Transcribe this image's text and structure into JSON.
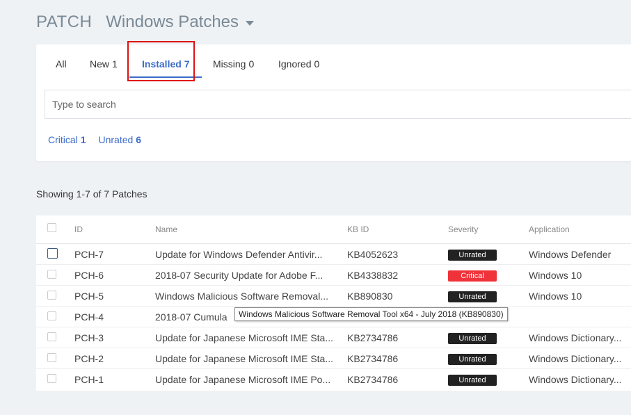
{
  "header": {
    "module": "PATCH",
    "view_title": "Windows Patches"
  },
  "tabs": [
    {
      "label": "All",
      "count": ""
    },
    {
      "label": "New",
      "count": "1"
    },
    {
      "label": "Installed",
      "count": "7"
    },
    {
      "label": "Missing",
      "count": "0"
    },
    {
      "label": "Ignored",
      "count": "0"
    }
  ],
  "search": {
    "placeholder": "Type to search",
    "value": ""
  },
  "severity_filters": [
    {
      "label": "Critical",
      "count": "1"
    },
    {
      "label": "Unrated",
      "count": "6"
    }
  ],
  "summary": "Showing 1-7 of 7 Patches",
  "table": {
    "columns": [
      "ID",
      "Name",
      "KB ID",
      "Severity",
      "Application"
    ],
    "rows": [
      {
        "id": "PCH-7",
        "name": "Update for Windows Defender Antivir...",
        "kb": "KB4052623",
        "severity": "Unrated",
        "app": "Windows Defender"
      },
      {
        "id": "PCH-6",
        "name": "2018-07 Security Update for Adobe F...",
        "kb": "KB4338832",
        "severity": "Critical",
        "app": "Windows 10"
      },
      {
        "id": "PCH-5",
        "name": "Windows Malicious Software Removal...",
        "kb": "KB890830",
        "severity": "Unrated",
        "app": "Windows 10"
      },
      {
        "id": "PCH-4",
        "name": "2018-07 Cumula",
        "kb": "",
        "severity": "",
        "app": ""
      },
      {
        "id": "PCH-3",
        "name": "Update for Japanese Microsoft IME Sta...",
        "kb": "KB2734786",
        "severity": "Unrated",
        "app": "Windows Dictionary..."
      },
      {
        "id": "PCH-2",
        "name": "Update for Japanese Microsoft IME Sta...",
        "kb": "KB2734786",
        "severity": "Unrated",
        "app": "Windows Dictionary..."
      },
      {
        "id": "PCH-1",
        "name": "Update for Japanese Microsoft IME Po...",
        "kb": "KB2734786",
        "severity": "Unrated",
        "app": "Windows Dictionary..."
      }
    ]
  },
  "tooltip": "Windows Malicious Software Removal Tool x64 - July 2018 (KB890830)",
  "colors": {
    "accent": "#3b6bc8",
    "critical": "#f0323a",
    "unrated": "#222222",
    "highlight": "#e01010"
  }
}
